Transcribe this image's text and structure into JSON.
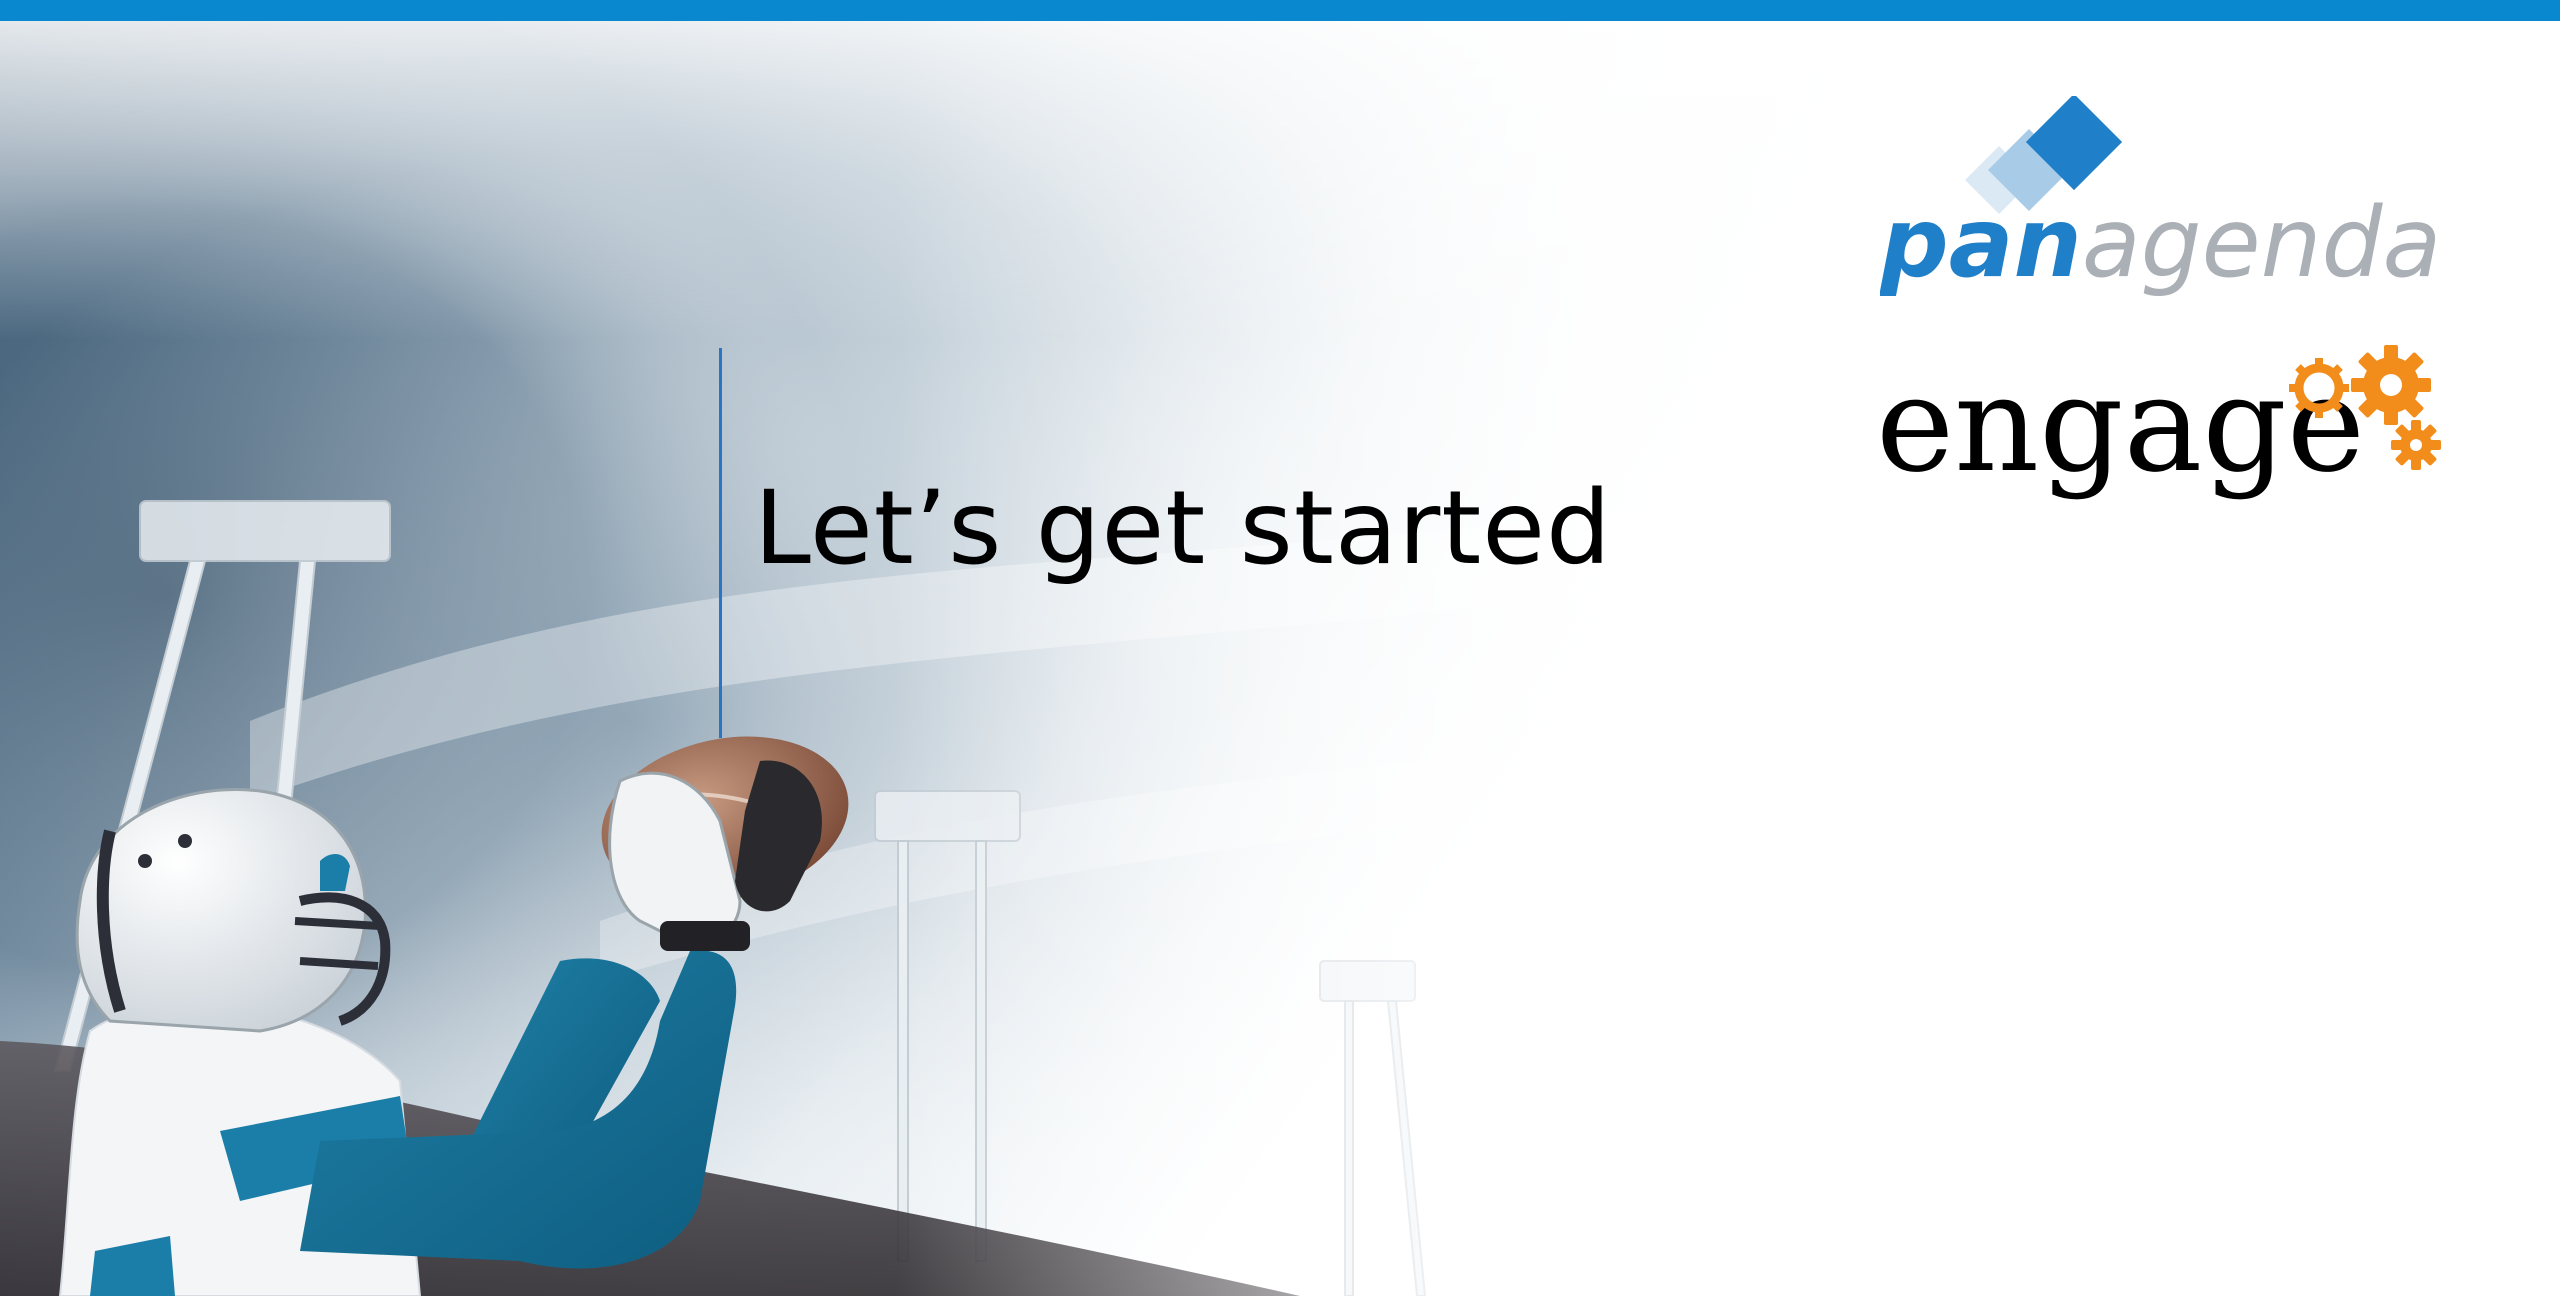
{
  "slide": {
    "title": "Let’s get started"
  },
  "logos": {
    "panagenda": {
      "text_bold": "pan",
      "text_light": "agenda",
      "icon": "diamond-stack-icon"
    },
    "engage": {
      "text": "engage",
      "icon": "gears-icon"
    }
  },
  "photo": {
    "subject": "football-player-catching-ball-icon"
  },
  "colors": {
    "top_bar": "#0a88cf",
    "divider": "#2a74c6",
    "panagenda_blue": "#1f7fc8",
    "panagenda_gray": "#aab0b6",
    "engage_orange": "#f28c1a",
    "title": "#000000"
  }
}
